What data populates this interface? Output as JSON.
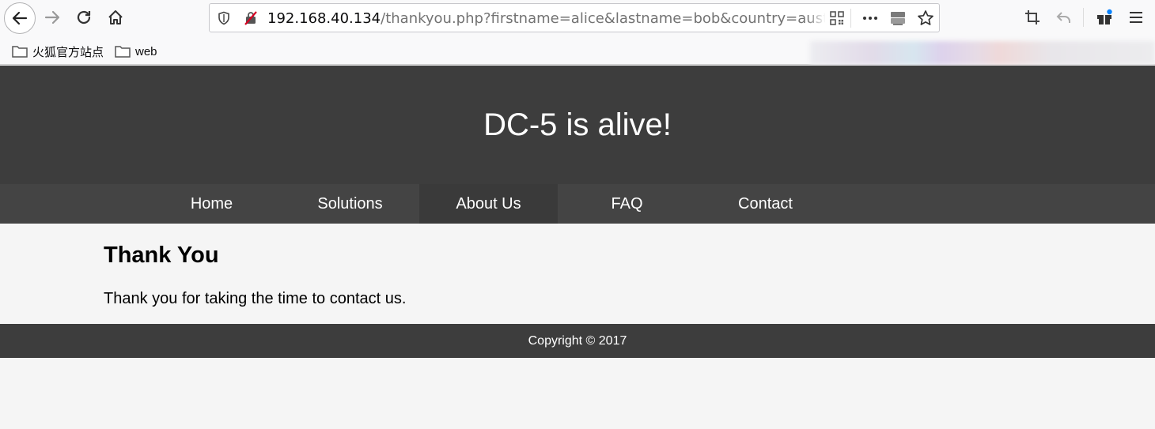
{
  "browser": {
    "url_host": "192.168.40.134",
    "url_path": "/thankyou.php?firstname=alice&lastname=bob&country=australia&su",
    "bookmarks": [
      {
        "label": "火狐官方站点"
      },
      {
        "label": "web"
      }
    ]
  },
  "site": {
    "title": "DC-5 is alive!",
    "nav": [
      {
        "label": "Home"
      },
      {
        "label": "Solutions"
      },
      {
        "label": "About Us"
      },
      {
        "label": "FAQ"
      },
      {
        "label": "Contact"
      }
    ],
    "content": {
      "heading": "Thank You",
      "message": "Thank you for taking the time to contact us."
    },
    "footer": "Copyright © 2017"
  }
}
